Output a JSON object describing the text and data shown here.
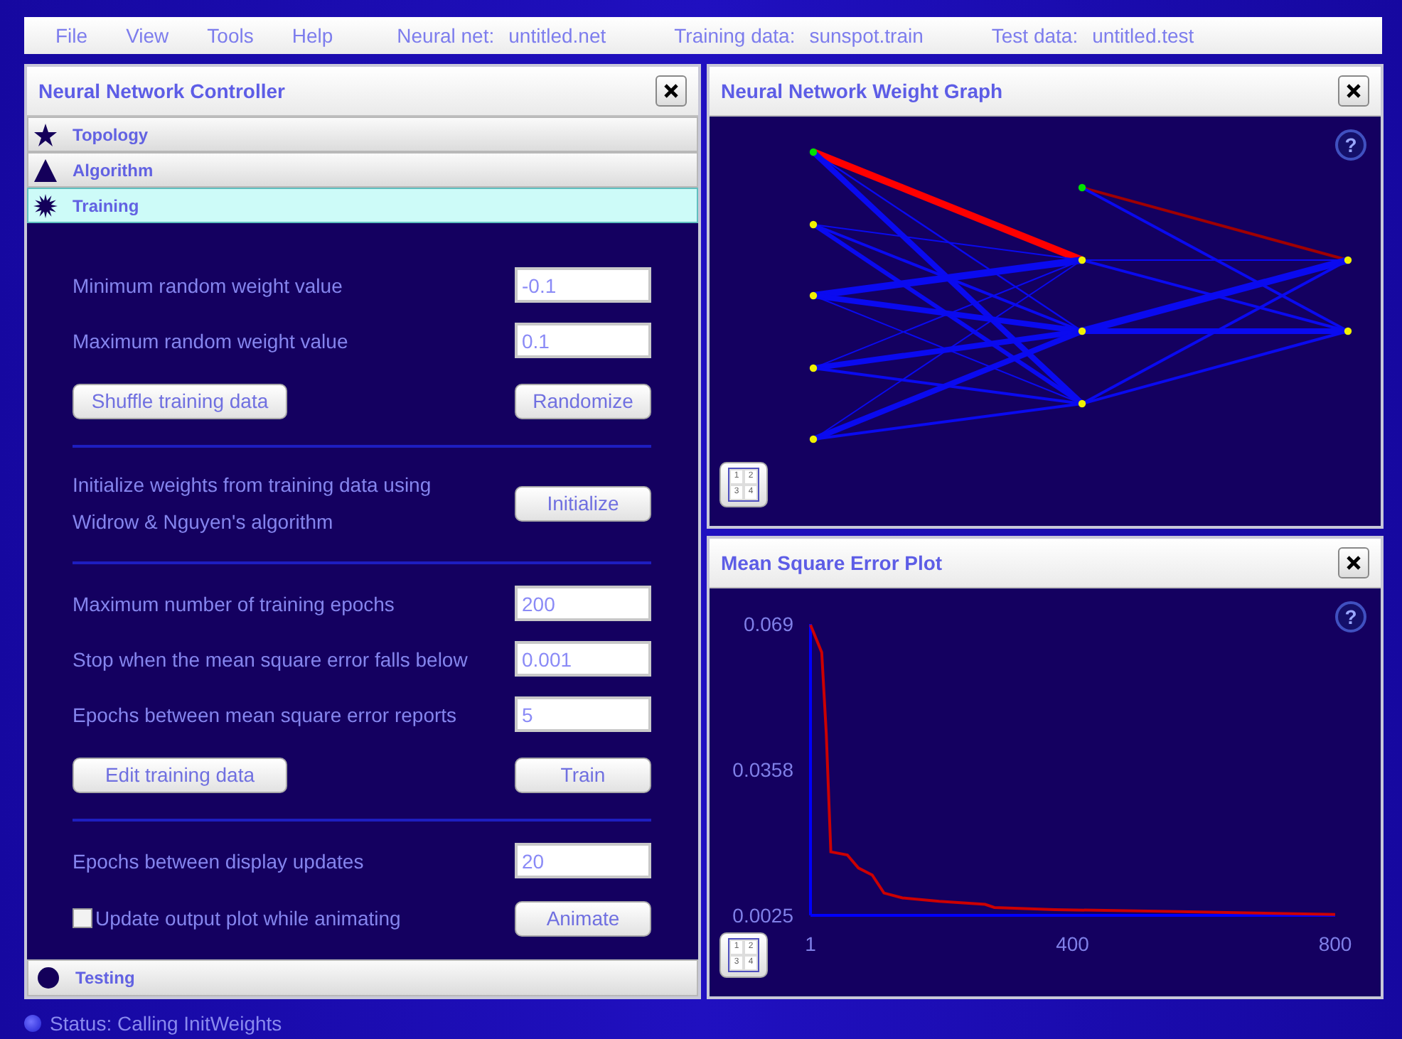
{
  "menu_bar": {
    "menus": [
      "File",
      "View",
      "Tools",
      "Help"
    ],
    "info": [
      {
        "label": "Neural net:",
        "value": "untitled.net"
      },
      {
        "label": "Training data:",
        "value": "sunspot.train"
      },
      {
        "label": "Test data:",
        "value": "untitled.test"
      }
    ]
  },
  "controller": {
    "title": "Neural Network Controller",
    "sections": [
      {
        "label": "Topology",
        "kind": "star",
        "selected": false
      },
      {
        "label": "Algorithm",
        "kind": "triangle",
        "selected": false
      },
      {
        "label": "Training",
        "kind": "burst",
        "selected": true
      },
      {
        "label": "Testing",
        "kind": "circle",
        "selected": false
      }
    ],
    "training_groups": [
      [
        {
          "kind": "field",
          "label": "Minimum random weight value",
          "value": "-0.1"
        },
        {
          "kind": "field",
          "label": "Maximum random weight value",
          "value": "0.1"
        },
        {
          "kind": "buttons",
          "left": "Shuffle training data",
          "right": "Randomize"
        }
      ],
      [
        {
          "kind": "note",
          "lines": [
            "Initialize weights from training data using",
            "Widrow & Nguyen's algorithm"
          ],
          "button": "Initialize"
        }
      ],
      [
        {
          "kind": "field",
          "label": "Maximum number of training epochs",
          "value": "200"
        },
        {
          "kind": "field",
          "label": "Stop when the mean square error falls below",
          "value": "0.001"
        },
        {
          "kind": "field",
          "label": "Epochs between mean square error reports",
          "value": "5"
        },
        {
          "kind": "buttons",
          "left": "Edit training data",
          "right": "Train"
        }
      ],
      [
        {
          "kind": "field",
          "label": "Epochs between display updates",
          "value": "20"
        },
        {
          "kind": "checkbox",
          "label": "Update output plot while animating",
          "checked": false,
          "button": "Animate"
        }
      ]
    ]
  },
  "weight_graph": {
    "title": "Neural Network Weight Graph",
    "help": "?",
    "layout_grid": [
      "1",
      "2",
      "3",
      "4"
    ]
  },
  "error_plot": {
    "title": "Mean Square Error Plot",
    "help": "?",
    "layout_grid": [
      "1",
      "2",
      "3",
      "4"
    ],
    "chart_data": {
      "type": "line",
      "x": [
        1,
        18,
        25,
        32,
        57,
        74,
        95,
        113,
        141,
        197,
        267,
        281,
        373,
        548,
        800
      ],
      "series": [
        {
          "color": "#cc0000",
          "values": [
            0.0688,
            0.0625,
            0.044,
            0.017,
            0.0163,
            0.0133,
            0.0117,
            0.0076,
            0.0065,
            0.0057,
            0.005,
            0.0043,
            0.0038,
            0.0034,
            0.0027
          ]
        }
      ],
      "xlim": [
        1,
        800
      ],
      "ylim": [
        0.0025,
        0.069
      ],
      "xticks": [
        1,
        400,
        800
      ],
      "yticks": [
        0.0025,
        0.0358,
        0.069
      ]
    }
  },
  "status_bar": {
    "text": "Status: Calling InitWeights"
  }
}
